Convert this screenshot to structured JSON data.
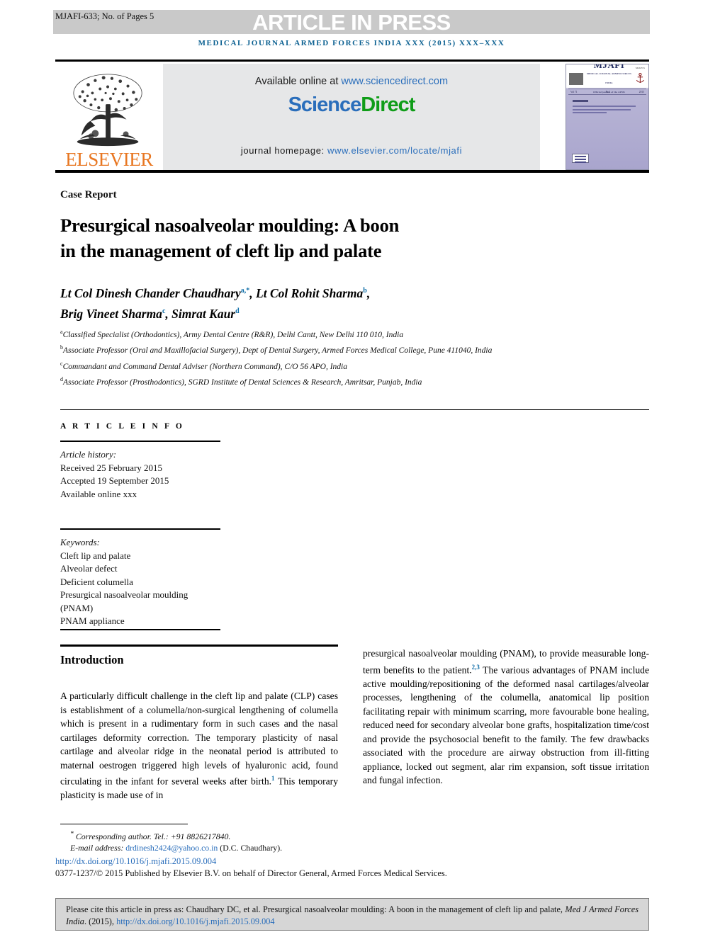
{
  "banner": {
    "article_id": "MJAFI-633; No. of Pages 5",
    "in_press": "ARTICLE IN PRESS",
    "band_color": "#c9c9c9"
  },
  "running_head": {
    "text": "MEDICAL JOURNAL ARMED FORCES INDIA XXX (2015) XXX–XXX",
    "color": "#0b6091"
  },
  "masthead": {
    "publisher_name": "ELSEVIER",
    "publisher_color": "#e87722",
    "available_prefix": "Available online at ",
    "available_url": "www.sciencedirect.com",
    "sciencedirect_part1": "Science",
    "sciencedirect_part2": "Direct",
    "sciencedirect_blue": "#2a6ebb",
    "sciencedirect_green": "#0f9d18",
    "homepage_prefix": "journal homepage: ",
    "homepage_url": "www.elsevier.com/locate/mjafi",
    "cover": {
      "top_note": "MJAFI  X",
      "journal_abbrev": "MJAFI",
      "journal_subtitle": "MEDICAL JOURNAL ARMED FORCES INDIA",
      "journal_tagline": "Official journal of the AFMS",
      "bar_left": "Vol 71",
      "bar_mid": "No 1",
      "bar_right": "2015"
    }
  },
  "article": {
    "type": "Case Report",
    "title_line1": "Presurgical nasoalveolar moulding: A boon",
    "title_line2": "in the management of cleft lip and palate",
    "authors": [
      {
        "name": "Lt Col Dinesh Chander Chaudhary",
        "marks": "a,*"
      },
      {
        "name": "Lt Col Rohit Sharma",
        "marks": "b"
      },
      {
        "name": "Brig Vineet Sharma",
        "marks": "c"
      },
      {
        "name": "Simrat Kaur",
        "marks": "d"
      }
    ],
    "affiliations": [
      {
        "mark": "a",
        "text": "Classified Specialist (Orthodontics), Army Dental Centre (R&R), Delhi Cantt, New Delhi 110 010, India"
      },
      {
        "mark": "b",
        "text": "Associate Professor (Oral and Maxillofacial Surgery), Dept of Dental Surgery, Armed Forces Medical College, Pune 411040, India"
      },
      {
        "mark": "c",
        "text": "Commandant and Command Dental Adviser (Northern Command), C/O 56 APO, India"
      },
      {
        "mark": "d",
        "text": "Associate Professor (Prosthodontics), SGRD Institute of Dental Sciences & Research, Amritsar, Punjab, India"
      }
    ]
  },
  "article_info": {
    "heading": "A R T I C L E   I N F O",
    "history_label": "Article history:",
    "history": [
      "Received 25 February 2015",
      "Accepted 19 September 2015",
      "Available online xxx"
    ],
    "keywords_label": "Keywords:",
    "keywords": [
      "Cleft lip and palate",
      "Alveolar defect",
      "Deficient columella",
      "Presurgical nasoalveolar moulding",
      "(PNAM)",
      "PNAM appliance"
    ]
  },
  "body": {
    "section_heading": "Introduction",
    "paragraph_left_a": "A particularly difficult challenge in the cleft lip and palate (CLP) cases is establishment of a columella/non-surgical lengthening of columella which is present in a rudimentary form in such cases and the nasal cartilages deformity correction. The temporary plasticity of nasal cartilage and alveolar ridge in the neonatal period is attributed to maternal oestrogen triggered high levels of hyaluronic acid, found circulating in the infant for several weeks after birth.",
    "paragraph_left_ref": "1",
    "paragraph_left_b": " This temporary plasticity is made use of in",
    "paragraph_right_a": "presurgical nasoalveolar moulding (PNAM), to provide measurable long-term benefits to the patient.",
    "paragraph_right_ref": "2,3",
    "paragraph_right_b": " The various advantages of PNAM include active moulding/repositioning of the deformed nasal cartilages/alveolar processes, lengthening of the columella, anatomical lip position facilitating repair with minimum scarring, more favourable bone healing, reduced need for secondary alveolar bone grafts, hospitalization time/cost and provide the psychosocial benefit to the family. The few drawbacks associated with the procedure are airway obstruction from ill-fitting appliance, locked out segment, alar rim expansion, soft tissue irritation and fungal infection."
  },
  "footnotes": {
    "corresponding_marker": "*",
    "corresponding_text": "Corresponding author. Tel.: +91 8826217840.",
    "email_label": "E-mail address: ",
    "email": "drdinesh2424@yahoo.co.in",
    "email_suffix": " (D.C. Chaudhary).",
    "doi": "http://dx.doi.org/10.1016/j.mjafi.2015.09.004",
    "copyright": "0377-1237/© 2015 Published by Elsevier B.V. on behalf of Director General, Armed Forces Medical Services."
  },
  "cite_box": {
    "prefix": "Please cite this article in press as: Chaudhary DC, et al. Presurgical nasoalveolar moulding: A boon in the management of cleft lip and palate, ",
    "journal": "Med J Armed Forces India",
    "middle": ". (2015), ",
    "doi": "http://dx.doi.org/10.1016/j.mjafi.2015.09.004",
    "background": "#d6d6d6"
  }
}
